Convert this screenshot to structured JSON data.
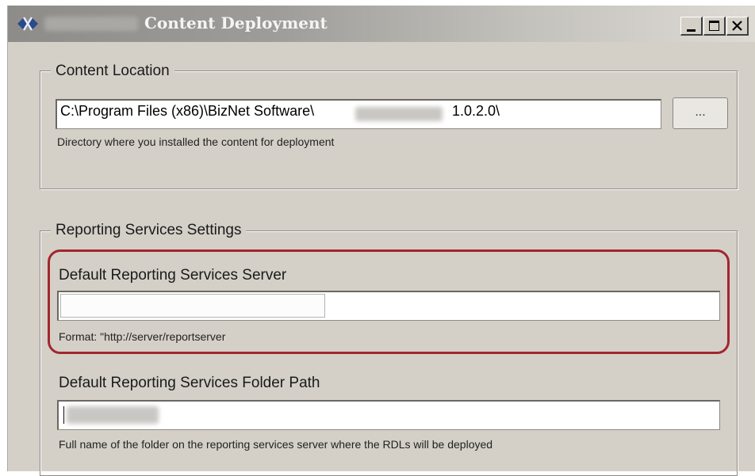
{
  "window": {
    "title": "Content Deployment",
    "buttons": {
      "minimize_icon": "minimize-icon",
      "maximize_icon": "maximize-icon",
      "close_icon": "close-icon"
    }
  },
  "content_location": {
    "legend": "Content Location",
    "path_value": "C:\\Program Files (x86)\\BizNet Software\\",
    "path_suffix": "1.0.2.0\\",
    "browse_label": "...",
    "hint": "Directory where you installed the content for deployment"
  },
  "reporting_services": {
    "legend": "Reporting Services Settings",
    "server_label": "Default Reporting Services Server",
    "server_value": "",
    "server_hint": "Format: \"http://server/reportserver",
    "folder_label": "Default Reporting Services Folder Path",
    "folder_value": "",
    "folder_hint": "Full name of the folder on the reporting services server where the RDLs will be deployed"
  },
  "colors": {
    "highlight": "#a3262e",
    "titlebar": "#8e8c89",
    "window_bg": "#d4d0c8"
  }
}
